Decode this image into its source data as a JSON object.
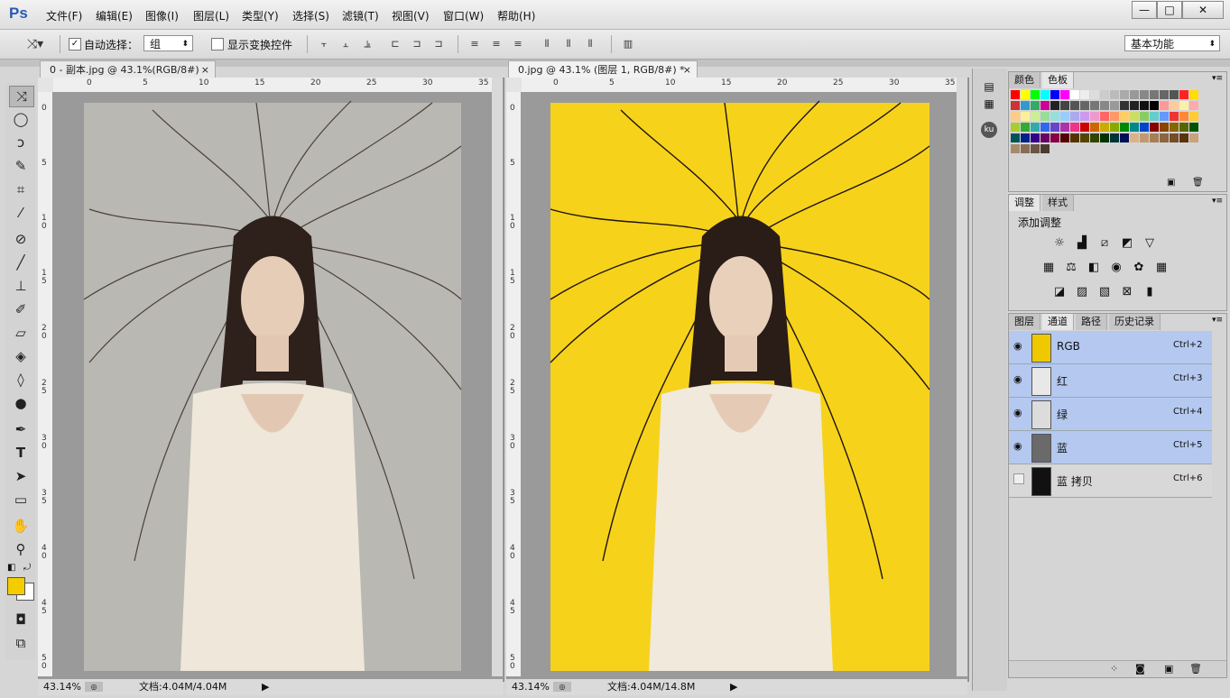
{
  "app": {
    "logo": "Ps"
  },
  "menu": [
    "文件(F)",
    "编辑(E)",
    "图像(I)",
    "图层(L)",
    "类型(Y)",
    "选择(S)",
    "滤镜(T)",
    "视图(V)",
    "窗口(W)",
    "帮助(H)"
  ],
  "window_controls": {
    "minimize": "—",
    "maximize": "□",
    "close": "✕"
  },
  "options": {
    "auto_select_label": "自动选择：",
    "auto_select_checked": "✓",
    "auto_select_value": "组",
    "show_transform_label": "显示变换控件",
    "workspace": "基本功能"
  },
  "tools": [
    "move-tool",
    "marquee-tool",
    "lasso-tool",
    "quick-select-tool",
    "crop-tool",
    "eyedropper-tool",
    "healing-tool",
    "brush-tool",
    "stamp-tool",
    "history-brush-tool",
    "eraser-tool",
    "bucket-tool",
    "blur-tool",
    "dodge-tool",
    "pen-tool",
    "type-tool",
    "path-select-tool",
    "shape-tool",
    "hand-tool",
    "zoom-tool"
  ],
  "colors": {
    "foreground": "#f5cc00",
    "background": "#ffffff",
    "doc2_bg": "#f7d21a",
    "doc1_bg": "#b9b8b3"
  },
  "doc1": {
    "tab_title": "0 - 副本.jpg @ 43.1%(RGB/8#)",
    "close": "×",
    "zoom": "43.14%",
    "doc_info": "文档:4.04M/4.04M",
    "ruler_h": [
      "0",
      "5",
      "10",
      "15",
      "20",
      "25",
      "30",
      "35"
    ],
    "ruler_v": [
      "0",
      "5",
      "1 0",
      "1 5",
      "2 0",
      "2 5",
      "3 0",
      "3 5",
      "4 0",
      "4 5",
      "5 0"
    ]
  },
  "doc2": {
    "tab_title": "0.jpg @ 43.1% (图层 1, RGB/8#) *",
    "close": "×",
    "zoom": "43.14%",
    "doc_info": "文档:4.04M/14.8M",
    "ruler_h": [
      "0",
      "5",
      "10",
      "15",
      "20",
      "25",
      "30",
      "35"
    ],
    "ruler_v": [
      "0",
      "5",
      "1 0",
      "1 5",
      "2 0",
      "2 5",
      "3 0",
      "3 5",
      "4 0",
      "4 5",
      "5 0"
    ]
  },
  "panel_color": {
    "tabs": [
      "颜色",
      "色板"
    ]
  },
  "panel_adjust": {
    "tabs": [
      "调整",
      "样式"
    ],
    "title": "添加调整"
  },
  "panel_channels": {
    "tabs": [
      "图层",
      "通道",
      "路径",
      "历史记录"
    ],
    "channels": [
      {
        "name": "RGB",
        "shortcut": "Ctrl+2",
        "visible": "◉"
      },
      {
        "name": "红",
        "shortcut": "Ctrl+3",
        "visible": "◉"
      },
      {
        "name": "绿",
        "shortcut": "Ctrl+4",
        "visible": "◉"
      },
      {
        "name": "蓝",
        "shortcut": "Ctrl+5",
        "visible": "◉"
      },
      {
        "name": "蓝 拷贝",
        "shortcut": "Ctrl+6",
        "visible": ""
      }
    ]
  },
  "side_icons": {
    "ku": "ku"
  }
}
